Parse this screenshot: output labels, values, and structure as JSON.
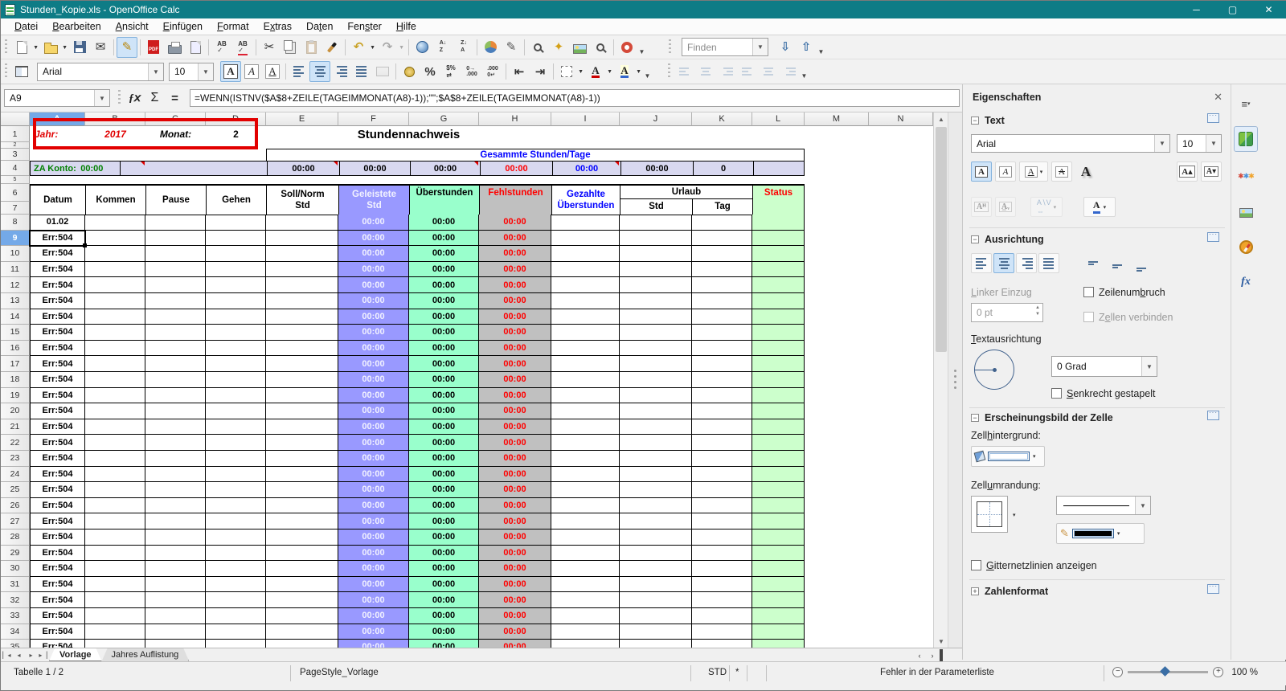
{
  "window": {
    "title": "Stunden_Kopie.xls - OpenOffice Calc"
  },
  "menu": {
    "items": [
      {
        "label": "Datei",
        "accel": 0
      },
      {
        "label": "Bearbeiten",
        "accel": 0
      },
      {
        "label": "Ansicht",
        "accel": 0
      },
      {
        "label": "Einfügen",
        "accel": 0
      },
      {
        "label": "Format",
        "accel": 0
      },
      {
        "label": "Extras",
        "accel": 1
      },
      {
        "label": "Daten",
        "accel": 2
      },
      {
        "label": "Fenster",
        "accel": 3
      },
      {
        "label": "Hilfe",
        "accel": 0
      }
    ]
  },
  "standard_toolbar": {
    "icons": [
      {
        "name": "new-document",
        "dd": true
      },
      {
        "name": "open",
        "dd": true
      },
      {
        "name": "save"
      },
      {
        "name": "email"
      },
      {
        "sep": true
      },
      {
        "name": "edit-mode",
        "active": true
      },
      {
        "sep": true
      },
      {
        "name": "export-pdf"
      },
      {
        "name": "print"
      },
      {
        "name": "page-preview"
      },
      {
        "sep": true
      },
      {
        "name": "spelling"
      },
      {
        "name": "auto-spellcheck"
      },
      {
        "sep": true
      },
      {
        "name": "cut"
      },
      {
        "name": "copy"
      },
      {
        "name": "paste",
        "disabled": true
      },
      {
        "name": "format-paintbrush"
      },
      {
        "sep": true
      },
      {
        "name": "undo",
        "dd": true
      },
      {
        "name": "redo",
        "dd": true,
        "disabled": true
      },
      {
        "sep": true
      },
      {
        "name": "hyperlink"
      },
      {
        "name": "sort-ascending"
      },
      {
        "name": "sort-descending"
      },
      {
        "sep": true
      },
      {
        "name": "insert-chart"
      },
      {
        "name": "draw-functions"
      },
      {
        "sep": true
      },
      {
        "name": "find-replace"
      },
      {
        "name": "navigator"
      },
      {
        "name": "gallery"
      },
      {
        "name": "zoom"
      },
      {
        "sep": true
      },
      {
        "name": "help"
      }
    ]
  },
  "find_toolbar": {
    "placeholder": "Finden",
    "icons": [
      {
        "name": "find-down"
      },
      {
        "name": "find-up"
      }
    ]
  },
  "format_toolbar": {
    "font_name": "Arial",
    "font_size": "10",
    "icons": [
      {
        "name": "bold",
        "active": true
      },
      {
        "name": "italic"
      },
      {
        "name": "underline"
      },
      {
        "sep": true
      },
      {
        "name": "align-left"
      },
      {
        "name": "align-center",
        "active": true
      },
      {
        "name": "align-right"
      },
      {
        "name": "align-justify"
      },
      {
        "name": "merge-cells",
        "disabled": true
      },
      {
        "sep": true
      },
      {
        "name": "currency"
      },
      {
        "name": "percent"
      },
      {
        "name": "standard-format"
      },
      {
        "name": "add-decimal"
      },
      {
        "name": "delete-decimal"
      },
      {
        "sep": true
      },
      {
        "name": "decrease-indent"
      },
      {
        "name": "increase-indent"
      },
      {
        "sep": true
      },
      {
        "name": "borders",
        "dd": true
      },
      {
        "name": "font-color",
        "dd": true
      },
      {
        "name": "background-color",
        "dd": true
      }
    ],
    "object_icons": [
      "object-align-left",
      "object-align-center",
      "object-align-right",
      "object-align-top",
      "object-align-middle",
      "object-align-bottom"
    ]
  },
  "formula_bar": {
    "cell_ref": "A9",
    "formula": "=WENN(ISTNV($A$8+ZEILE(TAGEIMMONAT(A8)-1));\"\";$A$8+ZEILE(TAGEIMMONAT(A8)-1))"
  },
  "grid": {
    "columns": [
      "A",
      "B",
      "C",
      "D",
      "E",
      "F",
      "G",
      "H",
      "I",
      "J",
      "K",
      "L",
      "M",
      "N"
    ],
    "selected_column": "A",
    "selected_row": 9,
    "visible_rows": 35
  },
  "sheet": {
    "year_label": "Jahr:",
    "year": "2017",
    "month_label": "Monat:",
    "month": "2",
    "title": "Stundennachweis",
    "totals_header": "Gesammte Stunden/Tage",
    "za_label": "ZA Konto:",
    "za_value": "00:00",
    "totals": {
      "e": "00:00",
      "f": "00:00",
      "g": "00:00",
      "h": "00:00",
      "i": "00:00",
      "j": "00:00",
      "k": "0"
    },
    "table_headers": {
      "datum": "Datum",
      "kommen": "Kommen",
      "pause": "Pause",
      "gehen": "Gehen",
      "soll_1": "Soll/Norm",
      "soll_2": "Std",
      "geleistete_1": "Geleistete",
      "geleistete_2": "Std",
      "ueberstunden": "Überstunden",
      "fehlstunden": "Fehlstunden",
      "gezahlte_1": "Gezahlte",
      "gezahlte_2": "Überstunden",
      "urlaub": "Urlaub",
      "urlaub_std": "Std",
      "urlaub_tag": "Tag",
      "status": "Status"
    },
    "rows": {
      "first_date": "01.02",
      "error_value": "Err:504",
      "error_row_count": 27,
      "time_value": "00:00"
    }
  },
  "tabs": {
    "sheets": [
      {
        "name": "Vorlage",
        "active": true
      },
      {
        "name": "Jahres Auflistung",
        "active": false
      }
    ]
  },
  "statusbar": {
    "sheet_info": "Tabelle 1 / 2",
    "page_style": "PageStyle_Vorlage",
    "insert_mode": "STD",
    "modified": "*",
    "message": "Fehler in der Parameterliste",
    "zoom": "100 %"
  },
  "sidebar": {
    "title": "Eigenschaften",
    "text_section": {
      "title": "Text",
      "font_name": "Arial",
      "font_size": "10"
    },
    "alignment_section": {
      "title": "Ausrichtung",
      "left_indent": {
        "label": "Linker Einzug",
        "accel": 0
      },
      "indent_value": "0 pt",
      "wrap": {
        "label": "Zeilenumbruch",
        "accel": 8
      },
      "merge": {
        "label": "Zellen verbinden",
        "accel": 1
      },
      "orientation": {
        "label": "Textausrichtung",
        "accel": 0
      },
      "degrees": "0 Grad",
      "stacked": {
        "label": "Senkrecht gestapelt",
        "accel": 0
      }
    },
    "appearance_section": {
      "title": "Erscheinungsbild der Zelle",
      "background": {
        "label": "Zellhintergrund:",
        "accel": 4
      },
      "border": {
        "label": "Zellumrandung:",
        "accel": 4
      },
      "gridlines": {
        "label": "Gitternetzlinien anzeigen",
        "accel": 0
      }
    },
    "number_section": {
      "title": "Zahlenformat"
    }
  },
  "colors": {
    "titlebar": "#0e7c86",
    "worked_bg": "#9999FF",
    "overtime_bg": "#99FFCC",
    "missing_bg": "#C0C0C0",
    "status_bg": "#CCFFCC",
    "totals_band_bg": "#D8D8F0",
    "annotation_red": "#E20000",
    "error_text": "#000000",
    "negative_text": "#FF0000",
    "blue_text": "#0000FF",
    "green_text": "#008000"
  }
}
